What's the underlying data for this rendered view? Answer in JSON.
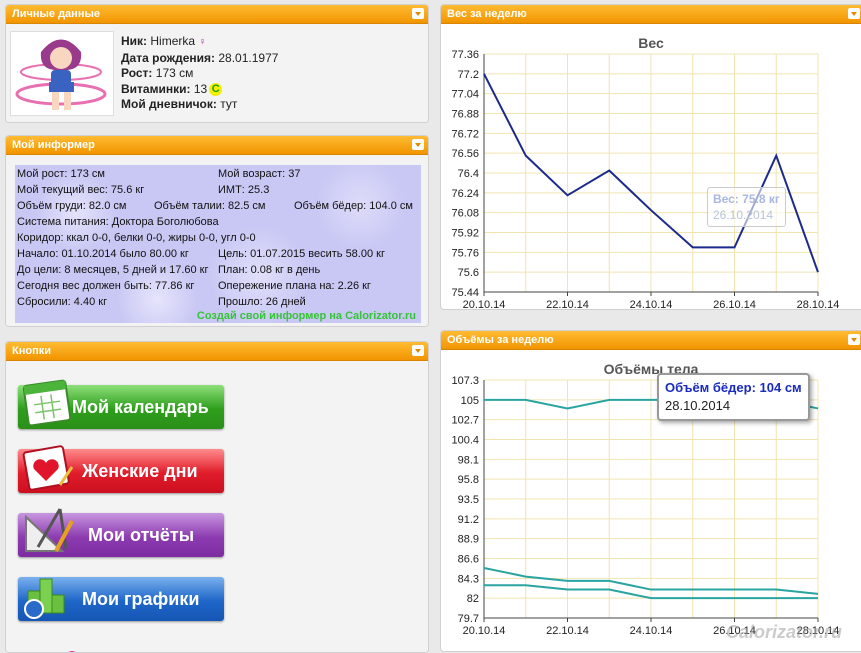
{
  "personal": {
    "header": "Личные данные",
    "nick_label": "Ник:",
    "nick_value": "Himerka",
    "birth_label": "Дата рождения:",
    "birth_value": "28.01.1977",
    "height_label": "Рост:",
    "height_value": "173 см",
    "vitamins_label": "Витаминки:",
    "vitamins_value": "13",
    "vitamins_badge": "C",
    "diary_label": "Мой дневничок:",
    "diary_value": "тут"
  },
  "informer": {
    "header": "Мой информер",
    "height": "Мой рост: 173 см",
    "age": "Мой возраст: 37",
    "weight": "Мой текущий вес: 75.6 кг",
    "bmi": "ИМТ: 25.3",
    "chest": "Объём груди: 82.0 см",
    "waist": "Объём талии: 82.5 см",
    "hips": "Объём бёдер: 104.0 см",
    "diet": "Система питания: Доктора Боголюбова",
    "corridor": "Коридор: ккал 0-0, белки 0-0, жиры 0-0, угл 0-0",
    "start": "Начало: 01.10.2014 было 80.00 кг",
    "goal": "Цель: 01.07.2015 весить 58.00 кг",
    "to_goal": "До цели: 8 месяцев, 5 дней и 17.60 кг",
    "plan": "План: 0.08 кг в день",
    "today_should": "Сегодня вес должен быть: 77.86 кг",
    "ahead": "Опережение плана на: 2.26 кг",
    "lost": "Сбросили: 4.40 кг",
    "passed": "Прошло: 26 дней",
    "link": "Создай свой информер на Calorizator.ru"
  },
  "buttons": {
    "header": "Кнопки",
    "calendar": "Мой календарь",
    "female_days": "Женские дни",
    "reports": "Мои отчёты",
    "graphs": "Мои графики"
  },
  "weight_panel": {
    "header": "Вес за неделю",
    "tooltip_value": "Вес: 75.8 кг",
    "tooltip_date": "26.10.2014"
  },
  "volume_panel": {
    "header": "Объёмы за неделю",
    "tooltip_value": "Объём бёдер: 104 см",
    "tooltip_date": "28.10.2014",
    "watermark": "Calorizator.ru"
  },
  "colors": {
    "header_orange": "#f4a000",
    "weight_line": "#1b2a8c",
    "volume_line": "#2aa4a0"
  },
  "chart_data": [
    {
      "type": "line",
      "title": "Вес",
      "x": [
        "21.10.14",
        "22.10.14",
        "23.10.14",
        "24.10.14",
        "25.10.14",
        "26.10.14",
        "27.10.14",
        "28.10.14"
      ],
      "xticks": [
        "20.10.14",
        "22.10.14",
        "24.10.14",
        "26.10.14",
        "28.10.14"
      ],
      "yticks": [
        "75.44",
        "75.6",
        "75.76",
        "75.92",
        "76.08",
        "76.24",
        "76.4",
        "76.56",
        "76.72",
        "76.88",
        "77.04",
        "77.2",
        "77.36"
      ],
      "ylim": [
        75.44,
        77.36
      ],
      "series": [
        {
          "values": [
            77.2,
            76.54,
            76.22,
            76.42,
            76.1,
            75.8,
            75.8,
            76.54,
            75.6
          ]
        }
      ],
      "series_x": [
        "20.10.14",
        "21.10.14",
        "22.10.14",
        "23.10.14",
        "24.10.14",
        "25.10.14",
        "26.10.14",
        "27.10.14",
        "28.10.14"
      ],
      "grid": true
    },
    {
      "type": "line",
      "title": "Объёмы тела",
      "xticks": [
        "20.10.14",
        "22.10.14",
        "24.10.14",
        "26.10.14",
        "28.10.14"
      ],
      "yticks": [
        "79.7",
        "82",
        "84.3",
        "86.6",
        "88.9",
        "91.2",
        "93.5",
        "95.8",
        "98.1",
        "100.4",
        "102.7",
        "105",
        "107.3"
      ],
      "ylim": [
        79.7,
        107.3
      ],
      "series_x": [
        "20.10.14",
        "21.10.14",
        "22.10.14",
        "23.10.14",
        "24.10.14",
        "25.10.14",
        "26.10.14",
        "27.10.14",
        "28.10.14"
      ],
      "series": [
        {
          "values": [
            105,
            105,
            104,
            105,
            105,
            105,
            105,
            105,
            104
          ]
        },
        {
          "values": [
            85.5,
            84.5,
            84,
            84,
            83,
            83,
            83,
            83,
            82.5
          ]
        },
        {
          "values": [
            83.5,
            83.5,
            83,
            83,
            82,
            82,
            82,
            82,
            82
          ]
        }
      ],
      "grid": true
    }
  ]
}
